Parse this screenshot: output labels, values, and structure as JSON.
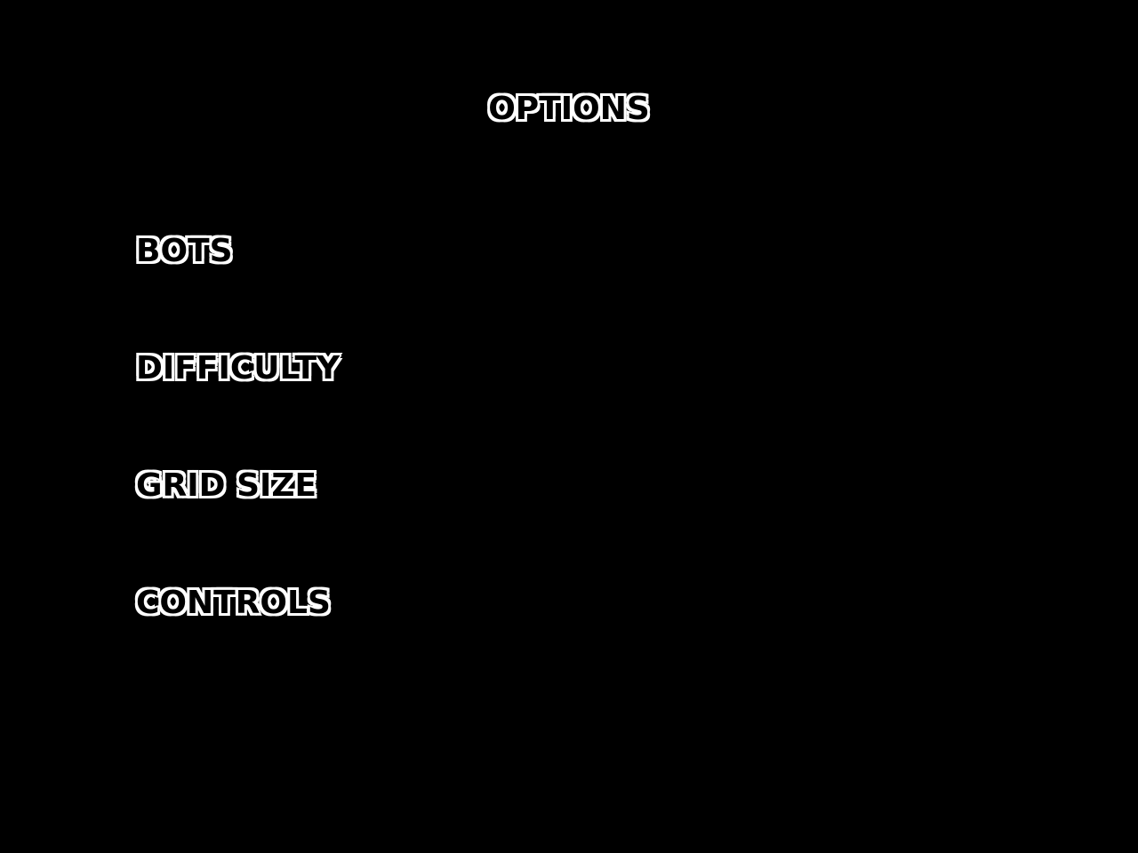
{
  "screen": {
    "title": "OPTIONS",
    "background_color": "#000000",
    "text_color": "#ffffff"
  },
  "menu": {
    "items": [
      {
        "label": "BOTS"
      },
      {
        "label": "DIFFICULTY"
      },
      {
        "label": "GRID SIZE"
      },
      {
        "label": "CONTROLS"
      }
    ]
  }
}
